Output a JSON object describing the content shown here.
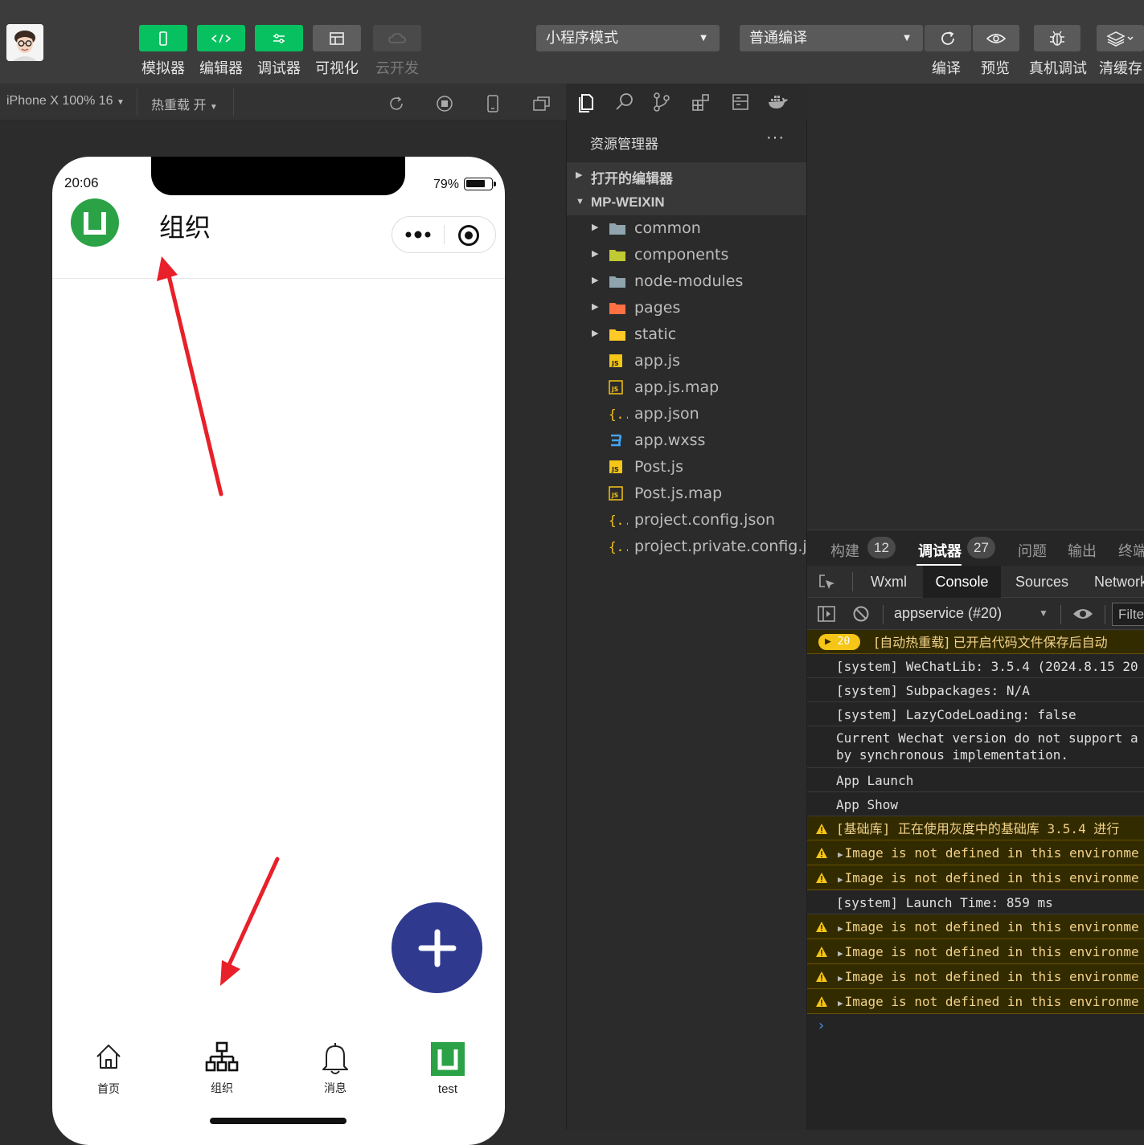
{
  "toolbar": {
    "simulator": "模拟器",
    "editor": "编辑器",
    "debugger": "调试器",
    "visual": "可视化",
    "cloud": "云开发",
    "mode_select": "小程序模式",
    "compile_select": "普通编译",
    "compile": "编译",
    "preview": "预览",
    "remote_debug": "真机调试",
    "clear_cache": "清缓存"
  },
  "sim_bar": {
    "device": "iPhone X 100% 16",
    "hot_reload": "热重载 开"
  },
  "phone": {
    "time": "20:06",
    "battery": "79%",
    "battery_level": 0.79,
    "title": "组织",
    "tabs": [
      {
        "label": "首页",
        "icon": "home-icon"
      },
      {
        "label": "组织",
        "icon": "org-chart-icon"
      },
      {
        "label": "消息",
        "icon": "bell-icon"
      },
      {
        "label": "test",
        "icon": "uniapp-logo-icon"
      }
    ]
  },
  "explorer": {
    "title": "资源管理器",
    "open_editors": "打开的编辑器",
    "project": "MP-WEIXIN",
    "items": [
      {
        "name": "common",
        "type": "folder",
        "color": "#90a4ae"
      },
      {
        "name": "components",
        "type": "folder",
        "color": "#c0ca33"
      },
      {
        "name": "node-modules",
        "type": "folder",
        "color": "#90a4ae"
      },
      {
        "name": "pages",
        "type": "folder",
        "color": "#ff7043"
      },
      {
        "name": "static",
        "type": "folder",
        "color": "#ffca28"
      },
      {
        "name": "app.js",
        "type": "js"
      },
      {
        "name": "app.js.map",
        "type": "jsmap"
      },
      {
        "name": "app.json",
        "type": "json"
      },
      {
        "name": "app.wxss",
        "type": "css"
      },
      {
        "name": "Post.js",
        "type": "js"
      },
      {
        "name": "Post.js.map",
        "type": "jsmap"
      },
      {
        "name": "project.config.json",
        "type": "json"
      },
      {
        "name": "project.private.config.js...",
        "type": "json"
      }
    ]
  },
  "panel_tabs": [
    {
      "label": "构建",
      "badge": "12"
    },
    {
      "label": "调试器",
      "badge": "27"
    },
    {
      "label": "问题",
      "badge": ""
    },
    {
      "label": "输出",
      "badge": ""
    },
    {
      "label": "终端",
      "badge": ""
    }
  ],
  "dev_tabs": [
    "Wxml",
    "Console",
    "Sources",
    "Network"
  ],
  "console_bar": {
    "context": "appservice (#20)",
    "filter": "Filter"
  },
  "console": {
    "group_count": "20",
    "lines": [
      {
        "level": "group",
        "text": "[自动热重载] 已开启代码文件保存后自动"
      },
      {
        "level": "info",
        "text": "[system] WeChatLib: 3.5.4 (2024.8.15 20"
      },
      {
        "level": "info",
        "text": "[system] Subpackages: N/A"
      },
      {
        "level": "info",
        "text": "[system] LazyCodeLoading: false"
      },
      {
        "level": "info",
        "text": "Current Wechat version do not support a\nby synchronous implementation."
      },
      {
        "level": "info",
        "text": "App Launch"
      },
      {
        "level": "info",
        "text": "App Show"
      },
      {
        "level": "warn",
        "text": "[基础库] 正在使用灰度中的基础库 3.5.4 进行"
      },
      {
        "level": "warn",
        "text": "Image is not defined in this environme"
      },
      {
        "level": "warn",
        "text": "Image is not defined in this environme"
      },
      {
        "level": "info",
        "text": "[system] Launch Time: 859 ms"
      },
      {
        "level": "warn",
        "text": "Image is not defined in this environme"
      },
      {
        "level": "warn",
        "text": "Image is not defined in this environme"
      },
      {
        "level": "warn",
        "text": "Image is not defined in this environme"
      },
      {
        "level": "warn",
        "text": "Image is not defined in this environme"
      }
    ]
  },
  "colors": {
    "accent_green": "#07c160",
    "fab": "#2f3a8f",
    "annotation_arrow": "#e8202a",
    "uniapp_green": "#2ba245"
  }
}
